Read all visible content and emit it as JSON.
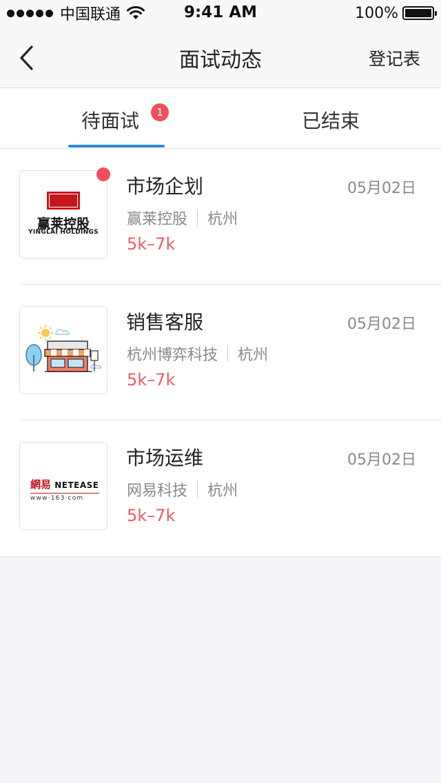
{
  "status_bar": {
    "carrier": "中国联通",
    "time": "9:41 AM",
    "battery": "100%"
  },
  "nav": {
    "back_icon": "chevron-left-icon",
    "title": "面试动态",
    "action": "登记表"
  },
  "tabs": [
    {
      "label": "待面试",
      "badge": "1",
      "active": true
    },
    {
      "label": "已结束",
      "active": false
    }
  ],
  "items": [
    {
      "title": "市场企划",
      "date": "05月02日",
      "company": "赢莱控股",
      "city": "杭州",
      "salary": "5k–7k",
      "unread": true,
      "logo": {
        "name": "yinglai-logo",
        "text": "赢莱控股",
        "subtext": "YINGLAI HOLDINGS"
      }
    },
    {
      "title": "销售客服",
      "date": "05月02日",
      "company": "杭州博弈科技",
      "city": "杭州",
      "salary": "5k–7k",
      "unread": false,
      "logo": {
        "name": "storefront-logo"
      }
    },
    {
      "title": "市场运维",
      "date": "05月02日",
      "company": "网易科技",
      "city": "杭州",
      "salary": "5k–7k",
      "unread": false,
      "logo": {
        "name": "netease-logo",
        "cn": "網易",
        "en": "NETEASE",
        "url": "www·163·com"
      }
    }
  ],
  "colors": {
    "accent": "#2f8ade",
    "badge": "#f0505b",
    "salary": "#ef5a5f"
  }
}
